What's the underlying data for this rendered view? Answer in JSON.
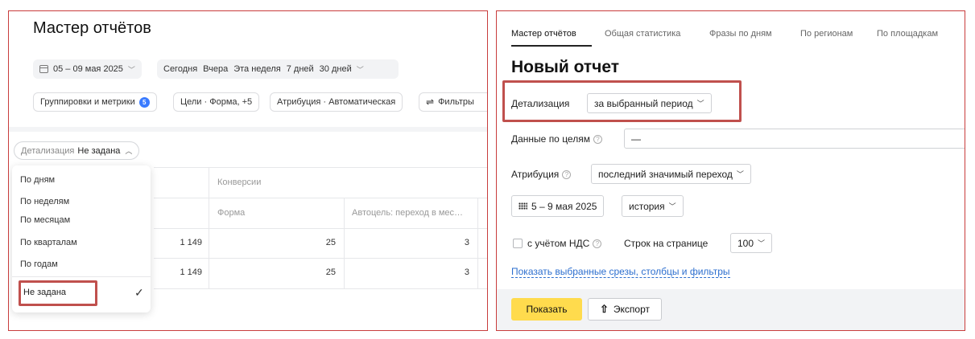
{
  "left": {
    "title": "Мастер отчётов",
    "date_range": "05 – 09 мая 2025",
    "quick_dates": [
      "Сегодня",
      "Вчера",
      "Эта неделя",
      "7 дней"
    ],
    "date_more": "30 дней",
    "groupings": "Группировки и метрики",
    "groupings_badge": "5",
    "goals": "Цели · Форма, +5",
    "attribution": "Атрибуция · Автоматическая",
    "filters": "Фильтры",
    "detail_label": "Детализация",
    "detail_value": "Не задана",
    "dropdown": {
      "items": [
        "По дням",
        "По неделям",
        "По месяцам",
        "По кварталам",
        "По годам"
      ],
      "selected": "Не задана"
    },
    "table": {
      "group_header": "Конверсии",
      "col_form": "Форма",
      "col_auto": "Автоцель: переход в мес…",
      "rows": [
        {
          "visits": "1 149",
          "form": "25",
          "auto": "3"
        },
        {
          "visits": "1 149",
          "form": "25",
          "auto": "3"
        }
      ]
    }
  },
  "right": {
    "tabs": [
      "Мастер отчётов",
      "Общая статистика",
      "Фразы по дням",
      "По регионам",
      "По площадкам"
    ],
    "title": "Новый отчет",
    "detail_label": "Детализация",
    "detail_value": "за выбранный период",
    "goals_label": "Данные по целям",
    "goals_value": "—",
    "attribution_label": "Атрибуция",
    "attribution_value": "последний значимый переход",
    "date_value": "5 – 9 мая 2025",
    "history_value": "история",
    "vat_label": "с учётом НДС",
    "rows_label": "Строк на странице",
    "rows_value": "100",
    "link": "Показать выбранные срезы, столбцы и фильтры",
    "show_button": "Показать",
    "export_button": "Экспорт"
  },
  "icons": [
    "calendar-icon",
    "chevron-down-icon",
    "filter-icon",
    "check-icon",
    "question-icon",
    "grid-calendar-icon",
    "export-icon"
  ]
}
